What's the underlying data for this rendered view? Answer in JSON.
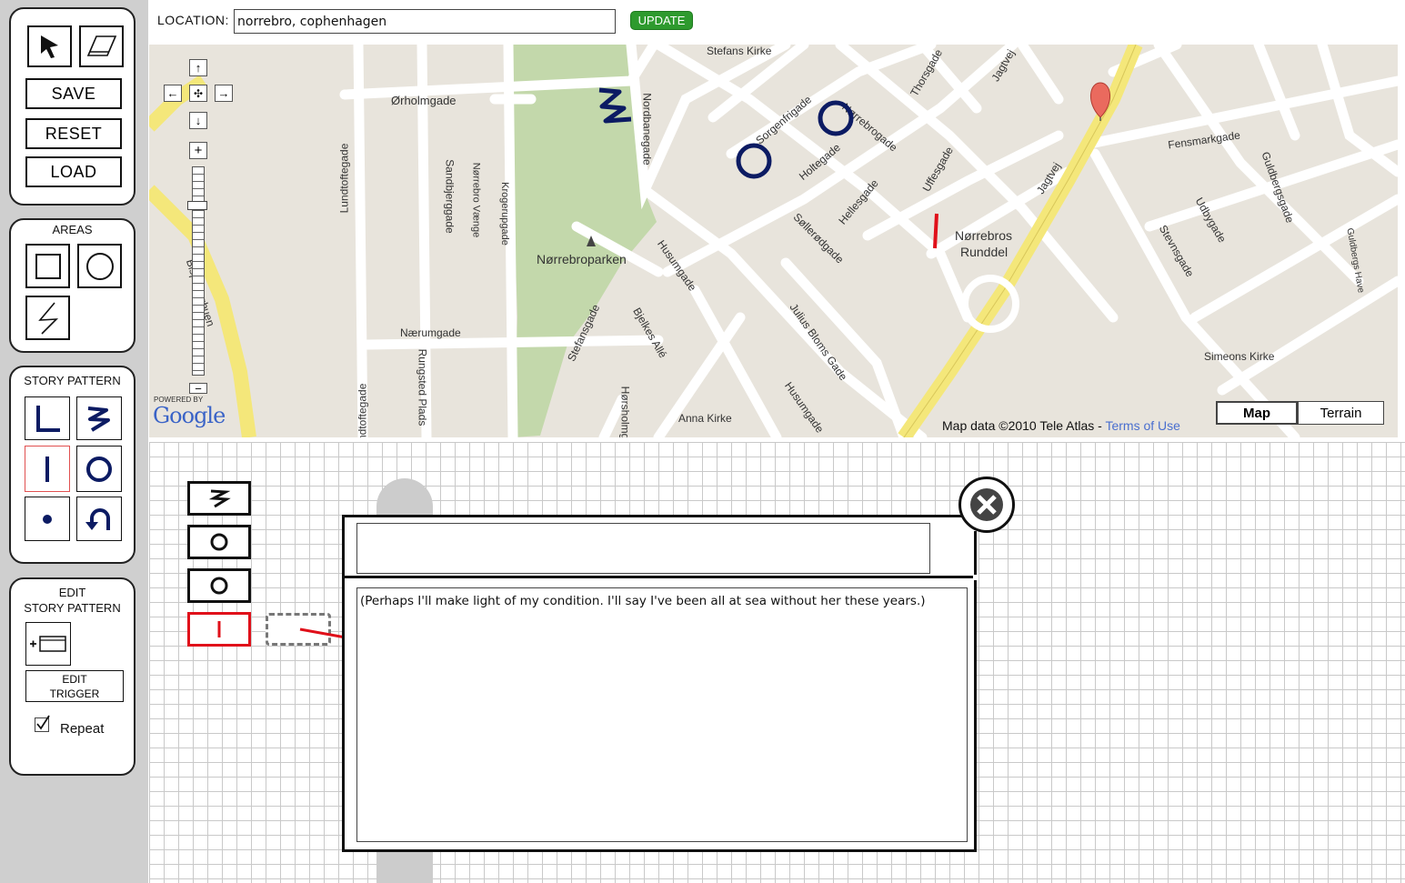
{
  "toolbar": {
    "save_label": "SAVE",
    "reset_label": "RESET",
    "load_label": "LOAD"
  },
  "areas": {
    "title": "AREAS"
  },
  "story_pattern": {
    "title": "STORY PATTERN"
  },
  "edit_panel": {
    "title_line1": "EDIT",
    "title_line2": "STORY PATTERN",
    "edit_trigger_line1": "EDIT",
    "edit_trigger_line2": "TRIGGER",
    "repeat_label": "Repeat",
    "repeat_checked": true
  },
  "location": {
    "label": "LOCATION:",
    "value": "norrebro, cophenhagen",
    "update_label": "UPDATE"
  },
  "map": {
    "streets": [
      "Stefans Kirke",
      "Ørholmgade",
      "Nordbanegade",
      "Sorgenfrigade",
      "Nørrebrogade",
      "Thorsgade",
      "Jagtvej",
      "Fensmarkgade",
      "Guldbergsgade",
      "Holtegade",
      "Uffesgade",
      "Jagtvej",
      "Lundtoftegade",
      "Sandbjerggade",
      "Nørrebro Vænge",
      "Krogerupgade",
      "Husumgade",
      "Søllerødgade",
      "Hellesgade",
      "Udbygade",
      "Stevnsgade",
      "Nørrebroparken",
      "Nærumgade",
      "Bjelkes Allé",
      "Julius Bloms Gade",
      "Stefansgade",
      "Rungsted Plads",
      "Anna Kirke",
      "Simeons Kirke",
      "Husumgade",
      "Hørsholmgade",
      "Lundtoftegade",
      "Bispeengbuen",
      "Guldbergs Have"
    ],
    "roundabout_line1": "Nørrebros",
    "roundabout_line2": "Runddel",
    "powered_by": "POWERED BY",
    "google": "Google",
    "attribution": "Map data ©2010  Tele Atlas - ",
    "terms": "Terms of Use",
    "type_map": "Map",
    "type_terrain": "Terrain"
  },
  "dialog": {
    "title_value": "",
    "body_text": "(Perhaps I'll make light of my condition.  I'll say I've been all at sea without her these years.)"
  },
  "colors": {
    "marker_blue": "#0c1b63",
    "marker_red": "#e0101a",
    "update_green": "#2e9a2e"
  }
}
